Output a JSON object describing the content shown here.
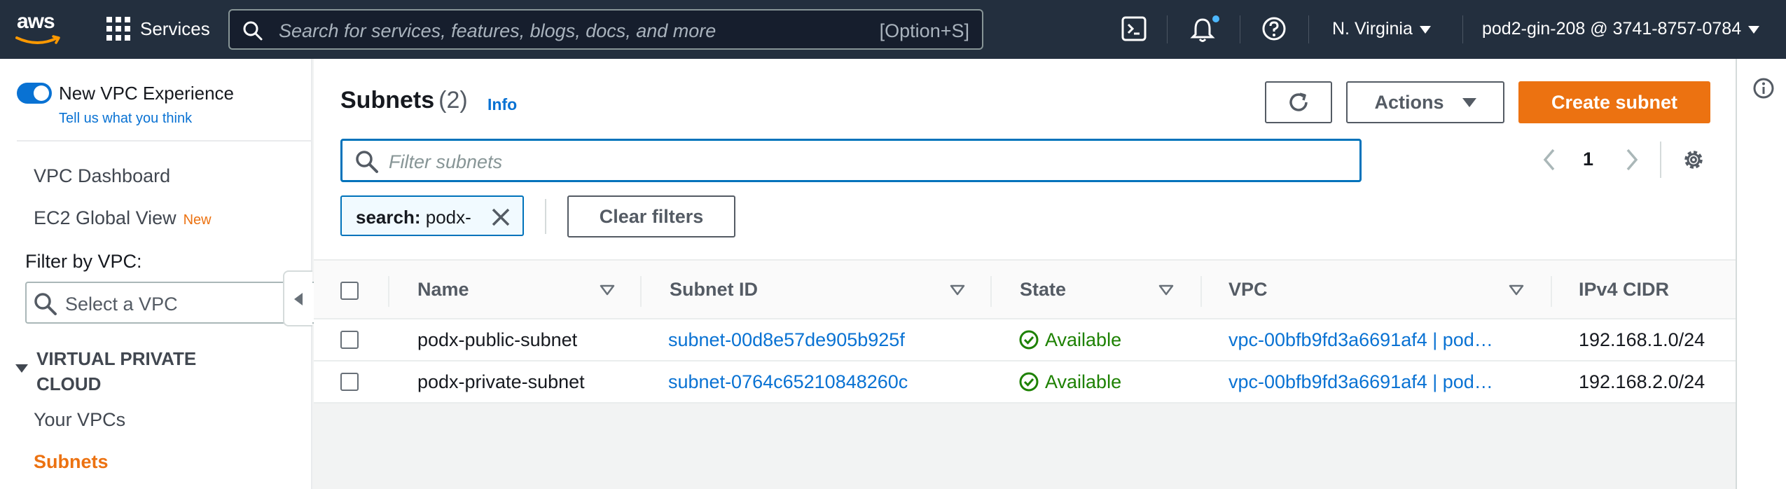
{
  "topbar": {
    "logo_text": "aws",
    "services_label": "Services",
    "search_placeholder": "Search for services, features, blogs, docs, and more",
    "search_shortcut": "[Option+S]",
    "region_label": "N. Virginia",
    "account_label": "pod2-gin-208 @ 3741-8757-0784",
    "icons": [
      "cloudshell-icon",
      "bell-icon",
      "help-icon"
    ],
    "notification_dot_color": "#4db8ff"
  },
  "sidebar": {
    "toggle_label": "New VPC Experience",
    "feedback_link": "Tell us what you think",
    "nav": {
      "vpc_dashboard": "VPC Dashboard",
      "ec2_global_view": "EC2 Global View",
      "ec2_global_view_badge": "New"
    },
    "filter_label": "Filter by VPC:",
    "vpc_select_placeholder": "Select a VPC",
    "section_title_line1": "VIRTUAL PRIVATE",
    "section_title_line2": "CLOUD",
    "section_items": {
      "your_vpcs": "Your VPCs",
      "subnets": "Subnets"
    },
    "active_color": "#ec7211"
  },
  "main": {
    "title": "Subnets",
    "count": "(2)",
    "info_link": "Info",
    "actions_label": "Actions",
    "create_label": "Create subnet",
    "filter_placeholder": "Filter subnets",
    "page_number": "1",
    "token": {
      "key": "search:",
      "value": "podx-"
    },
    "clear_filters_label": "Clear filters",
    "columns": [
      "Name",
      "Subnet ID",
      "State",
      "VPC",
      "IPv4 CIDR"
    ],
    "rows": [
      {
        "name": "podx-public-subnet",
        "subnet_id": "subnet-00d8e57de905b925f",
        "state": "Available",
        "vpc": "vpc-00bfb9fd3a6691af4 | pod…",
        "cidr": "192.168.1.0/24"
      },
      {
        "name": "podx-private-subnet",
        "subnet_id": "subnet-0764c65210848260c",
        "state": "Available",
        "vpc": "vpc-00bfb9fd3a6691af4 | pod…",
        "cidr": "192.168.2.0/24"
      }
    ]
  },
  "colors": {
    "topbar_bg": "#232f3e",
    "link": "#0972d3",
    "primary": "#ec7211",
    "available": "#1d8102"
  }
}
